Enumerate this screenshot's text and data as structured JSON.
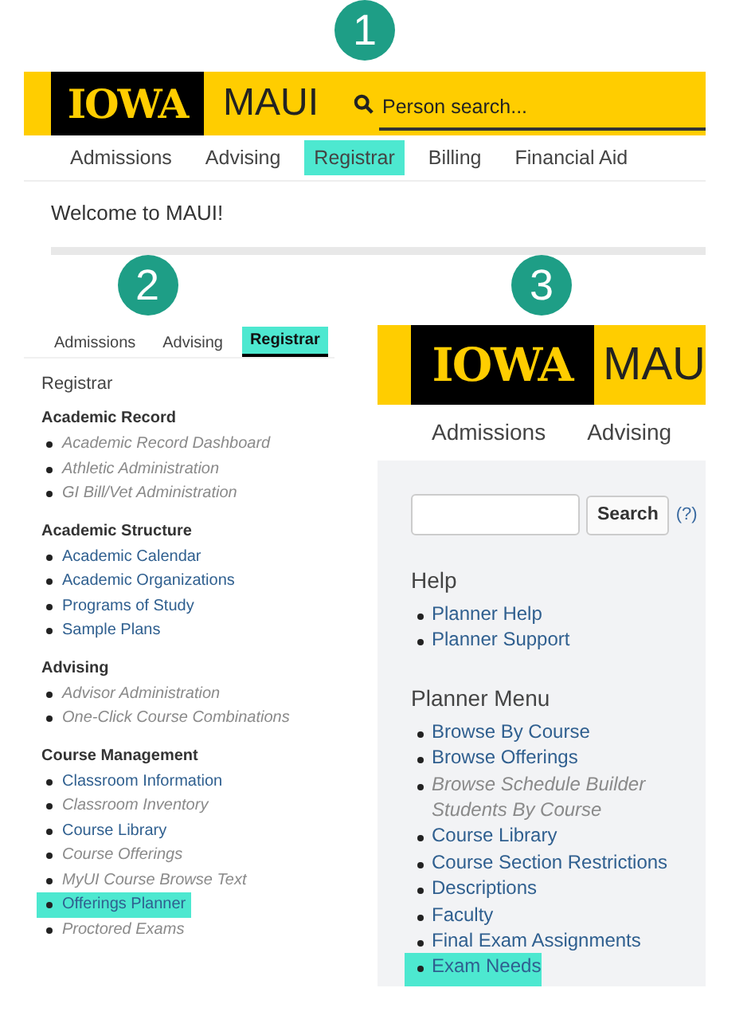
{
  "panels": [
    {
      "kind": "home",
      "step": "1",
      "logo": "IOWA",
      "app_title": "MAUI",
      "search": {
        "placeholder": "Person search..."
      },
      "tabs": [
        {
          "label": "Admissions",
          "selected": false
        },
        {
          "label": "Advising",
          "selected": false
        },
        {
          "label": "Registrar",
          "selected": true
        },
        {
          "label": "Billing",
          "selected": false
        },
        {
          "label": "Financial Aid",
          "selected": false
        }
      ],
      "welcome": "Welcome to MAUI!"
    },
    {
      "kind": "menu",
      "step": "2",
      "tabs": [
        {
          "label": "Admissions",
          "selected": false
        },
        {
          "label": "Advising",
          "selected": false
        },
        {
          "label": "Registrar",
          "selected": true
        }
      ],
      "title": "Registrar",
      "sections": [
        {
          "heading": "Academic Record",
          "items": [
            {
              "label": "Academic Record Dashboard",
              "disabled": true,
              "highlighted": false
            },
            {
              "label": "Athletic Administration",
              "disabled": true,
              "highlighted": false
            },
            {
              "label": "GI Bill/Vet Administration",
              "disabled": true,
              "highlighted": false
            }
          ]
        },
        {
          "heading": "Academic Structure",
          "items": [
            {
              "label": "Academic Calendar",
              "disabled": false,
              "highlighted": false
            },
            {
              "label": "Academic Organizations",
              "disabled": false,
              "highlighted": false
            },
            {
              "label": "Programs of Study",
              "disabled": false,
              "highlighted": false
            },
            {
              "label": "Sample Plans",
              "disabled": false,
              "highlighted": false
            }
          ]
        },
        {
          "heading": "Advising",
          "items": [
            {
              "label": "Advisor Administration",
              "disabled": true,
              "highlighted": false
            },
            {
              "label": "One-Click Course Combinations",
              "disabled": true,
              "highlighted": false
            }
          ]
        },
        {
          "heading": "Course Management",
          "items": [
            {
              "label": "Classroom Information",
              "disabled": false,
              "highlighted": false
            },
            {
              "label": "Classroom Inventory",
              "disabled": true,
              "highlighted": false
            },
            {
              "label": "Course Library",
              "disabled": false,
              "highlighted": false
            },
            {
              "label": "Course Offerings",
              "disabled": true,
              "highlighted": false
            },
            {
              "label": "MyUI Course Browse Text",
              "disabled": true,
              "highlighted": false
            },
            {
              "label": "Offerings Planner",
              "disabled": false,
              "highlighted": true
            },
            {
              "label": "Proctored Exams",
              "disabled": true,
              "highlighted": false
            }
          ]
        }
      ]
    },
    {
      "kind": "planner",
      "step": "3",
      "logo": "IOWA",
      "app_title": "MAU",
      "tabs": [
        {
          "label": "Admissions",
          "selected": false
        },
        {
          "label": "Advising",
          "selected": false
        }
      ],
      "search_button": "Search",
      "help_link": "(?)",
      "sections": [
        {
          "heading": "Help",
          "items": [
            {
              "label": "Planner Help",
              "disabled": false,
              "highlighted": false
            },
            {
              "label": "Planner Support",
              "disabled": false,
              "highlighted": false
            }
          ]
        },
        {
          "heading": "Planner Menu",
          "items": [
            {
              "label": "Browse By Course",
              "disabled": false,
              "highlighted": false
            },
            {
              "label": "Browse Offerings",
              "disabled": false,
              "highlighted": false
            },
            {
              "label": "Browse Schedule Builder Students By Course",
              "disabled": true,
              "highlighted": false
            },
            {
              "label": "Course Library",
              "disabled": false,
              "highlighted": false
            },
            {
              "label": "Course Section Restrictions",
              "disabled": false,
              "highlighted": false
            },
            {
              "label": "Descriptions",
              "disabled": false,
              "highlighted": false
            },
            {
              "label": "Faculty",
              "disabled": false,
              "highlighted": false
            },
            {
              "label": "Final Exam Assignments",
              "disabled": false,
              "highlighted": false
            },
            {
              "label": "Exam Needs",
              "disabled": false,
              "highlighted": true
            }
          ]
        }
      ]
    }
  ]
}
